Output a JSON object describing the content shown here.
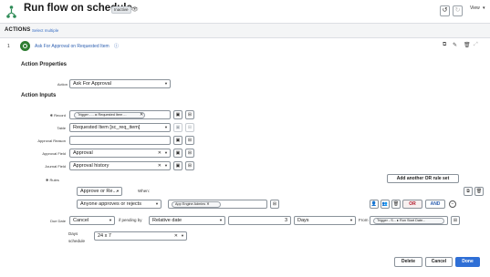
{
  "header": {
    "title": "Run flow on schedule",
    "status_badge": "Inactive",
    "view_label": "View"
  },
  "actions_bar": {
    "label": "ACTIONS",
    "select_multiple": "Select multiple"
  },
  "step": {
    "number": "1",
    "name": "Ask For Approval on Requested Item"
  },
  "action_properties": {
    "heading": "Action Properties",
    "action_label": "Action",
    "action_value": "Ask For Approval"
  },
  "action_inputs": {
    "heading": "Action Inputs",
    "record_label": "Record",
    "record_pill_1": "Trigger - ...",
    "record_pill_2": "Requested Item ...",
    "table_label": "Table",
    "table_value": "Requested Item [sc_req_item]",
    "approval_reason_label": "Approval Reason",
    "approval_reason_value": "",
    "approval_field_label": "Approval Field",
    "approval_field_value": "Approval",
    "journal_field_label": "Journal Field",
    "journal_field_value": "Approval history",
    "rules_label": "Rules",
    "add_or_rule_button": "Add another OR rule set",
    "rule_action_value": "Approve or Re...",
    "when_label": "When:",
    "rule_condition_value": "Anyone approves or rejects",
    "rule_group_pill": "App Engine Admins",
    "or_button": "OR",
    "and_button": "AND"
  },
  "due_date": {
    "label": "Due Date",
    "action_value": "Cancel",
    "if_pending_label": "if pending by",
    "type_value": "Relative date",
    "amount_value": "3",
    "unit_value": "Days",
    "from_label": "From",
    "from_pill_1": "Trigger - S...",
    "from_pill_2": "Run Start Date...",
    "days_schedule_label_1": "Days",
    "days_schedule_label_2": "schedule",
    "schedule_value": "24 x 7"
  },
  "footer": {
    "delete_button": "Delete",
    "cancel_button": "Cancel",
    "done_button": "Done"
  },
  "colors": {
    "primary": "#2f6fd6",
    "link": "#2d5fb0",
    "or_red": "#b0192b",
    "step_green": "#2e7d32"
  }
}
